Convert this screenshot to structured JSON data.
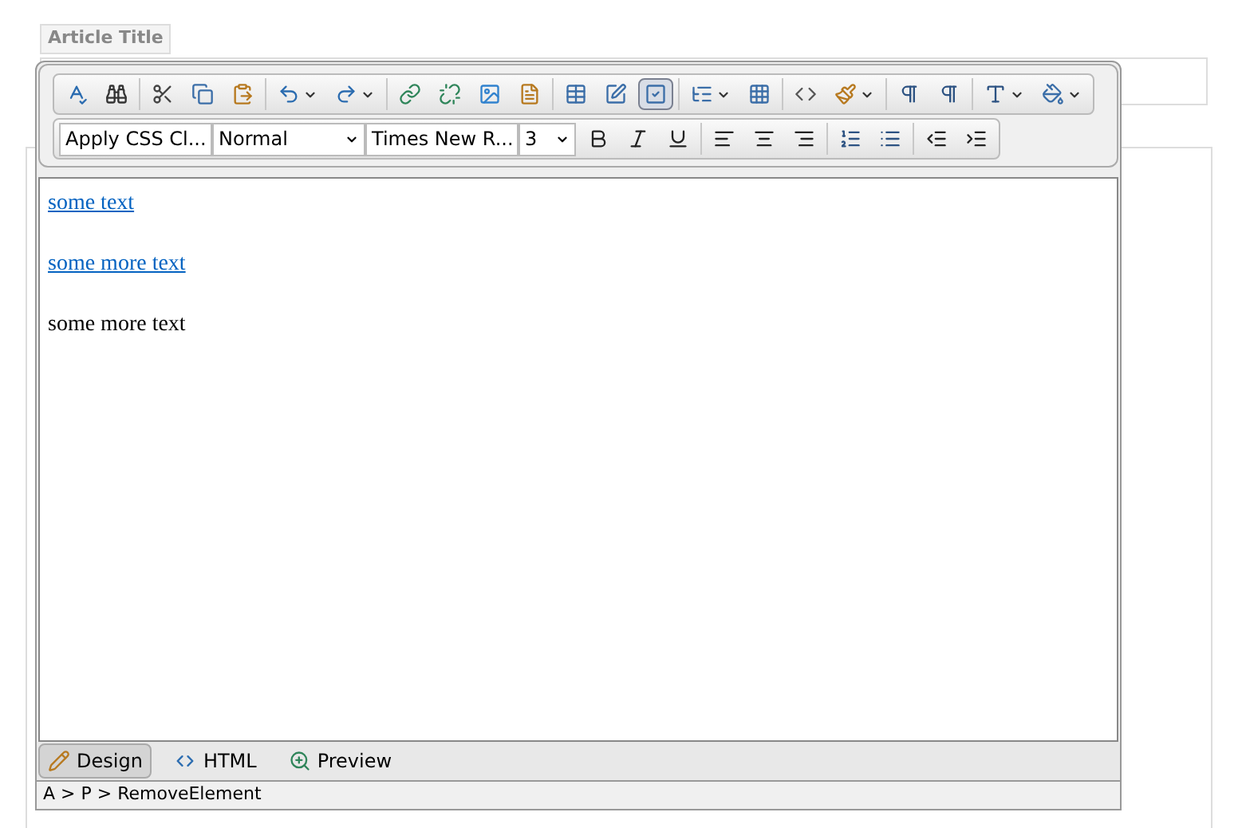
{
  "title_field": {
    "label": "Article Title"
  },
  "editor": {
    "toolbar_rows": [
      [
        [
          {
            "kind": "spellcheck",
            "dropdown": false,
            "selected": false
          },
          {
            "kind": "find",
            "dropdown": false,
            "selected": false
          }
        ],
        [
          {
            "kind": "cut",
            "dropdown": false,
            "selected": false
          },
          {
            "kind": "copy",
            "dropdown": false,
            "selected": false
          },
          {
            "kind": "paste",
            "dropdown": false,
            "selected": false
          }
        ],
        [
          {
            "kind": "undo",
            "dropdown": true,
            "selected": false
          },
          {
            "kind": "redo",
            "dropdown": true,
            "selected": false
          }
        ],
        [
          {
            "kind": "link",
            "dropdown": false,
            "selected": false
          },
          {
            "kind": "unlink",
            "dropdown": false,
            "selected": false
          },
          {
            "kind": "image",
            "dropdown": false,
            "selected": false
          },
          {
            "kind": "document",
            "dropdown": false,
            "selected": false
          }
        ],
        [
          {
            "kind": "table",
            "dropdown": false,
            "selected": false
          },
          {
            "kind": "edit",
            "dropdown": false,
            "selected": false
          },
          {
            "kind": "check",
            "dropdown": false,
            "selected": true
          }
        ],
        [
          {
            "kind": "tree",
            "dropdown": true,
            "selected": false
          },
          {
            "kind": "grid",
            "dropdown": false,
            "selected": false
          }
        ],
        [
          {
            "kind": "code",
            "dropdown": false,
            "selected": false
          },
          {
            "kind": "brush",
            "dropdown": true,
            "selected": false
          }
        ],
        [
          {
            "kind": "ltr",
            "dropdown": false,
            "selected": false
          },
          {
            "kind": "rtl",
            "dropdown": false,
            "selected": false
          }
        ],
        [
          {
            "kind": "font-color",
            "dropdown": true,
            "selected": false
          },
          {
            "kind": "fill",
            "dropdown": true,
            "selected": false
          }
        ]
      ],
      [
        [
          {
            "kind": "bold",
            "dropdown": false,
            "selected": false
          },
          {
            "kind": "italic",
            "dropdown": false,
            "selected": false
          },
          {
            "kind": "underline",
            "dropdown": false,
            "selected": false
          }
        ],
        [
          {
            "kind": "align-left",
            "dropdown": false,
            "selected": false
          },
          {
            "kind": "align-center",
            "dropdown": false,
            "selected": false
          },
          {
            "kind": "align-right",
            "dropdown": false,
            "selected": false
          }
        ],
        [
          {
            "kind": "ordered-list",
            "dropdown": false,
            "selected": false
          },
          {
            "kind": "bullet-list",
            "dropdown": false,
            "selected": false
          }
        ],
        [
          {
            "kind": "outdent",
            "dropdown": false,
            "selected": false
          },
          {
            "kind": "indent",
            "dropdown": false,
            "selected": false
          }
        ]
      ]
    ],
    "dropdowns": [
      {
        "value": "Apply CSS Cl..."
      },
      {
        "value": "Normal"
      },
      {
        "value": "Times New R..."
      },
      {
        "value": "3"
      }
    ],
    "paragraphs": [
      {
        "kind": "link",
        "text": "some text"
      },
      {
        "kind": "link",
        "text": "some more text"
      },
      {
        "kind": "text",
        "text": "some more text"
      }
    ],
    "tabs": [
      {
        "label": "Design",
        "selected": true
      },
      {
        "label": "HTML",
        "selected": false
      },
      {
        "label": "Preview",
        "selected": false
      }
    ],
    "status_path": "A > P > RemoveElement"
  }
}
